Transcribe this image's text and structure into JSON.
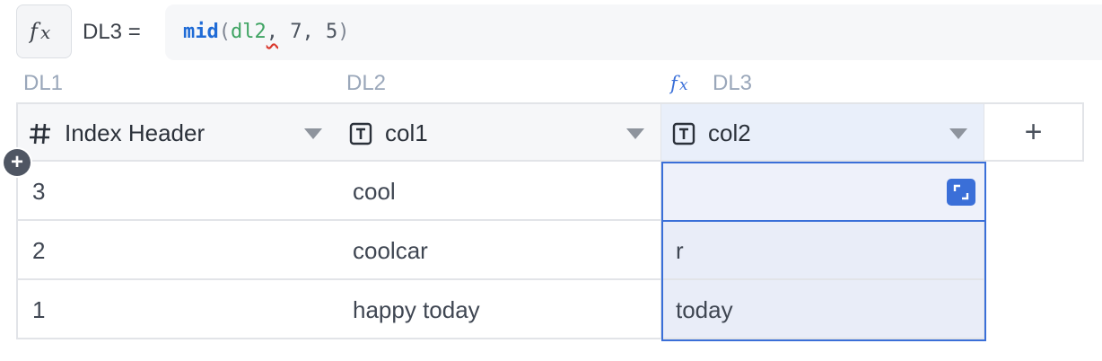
{
  "formula_bar": {
    "fx_icon": "function-fx-icon",
    "target": "DL3 =",
    "tokens": {
      "fn": "mid",
      "open": "(",
      "ref": "dl2",
      "comma1": ",",
      "arg2": " 7",
      "comma2": ",",
      "arg3": " 5",
      "close": ")"
    },
    "error_underline_color": "#d9362b"
  },
  "groups": [
    {
      "label": "DL1"
    },
    {
      "label": "DL2"
    },
    {
      "label": "DL3",
      "icon": "function-fx-icon"
    }
  ],
  "columns": [
    {
      "label": "Index Header",
      "type_icon": "number-hash-icon",
      "menu_icon": "caret-down-icon"
    },
    {
      "label": "col1",
      "type_icon": "text-type-icon",
      "menu_icon": "caret-down-icon"
    },
    {
      "label": "col2",
      "type_icon": "text-type-icon",
      "menu_icon": "caret-down-icon"
    }
  ],
  "add_column": {
    "label": "+"
  },
  "add_row": {
    "label": "+"
  },
  "rows": [
    [
      "3",
      "cool",
      ""
    ],
    [
      "2",
      "coolcar",
      "r"
    ],
    [
      "1",
      "happy today",
      "today"
    ]
  ],
  "colors": {
    "accent": "#3a6fd8",
    "selected_column_bg": "#e9edf8",
    "header_bg": "#f6f7f9",
    "formula_fn": "#1f6bd6",
    "formula_ref": "#3fa463"
  }
}
